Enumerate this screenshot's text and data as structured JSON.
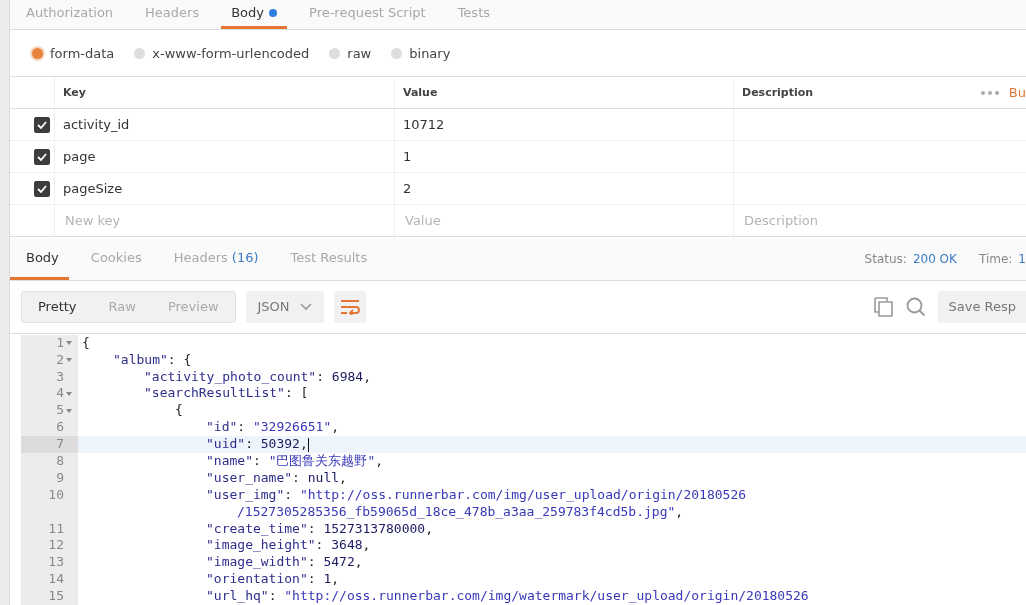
{
  "request_tabs": [
    {
      "label": "Authorization",
      "selected": false,
      "modified": false
    },
    {
      "label": "Headers",
      "selected": false,
      "modified": false
    },
    {
      "label": "Body",
      "selected": true,
      "modified": true
    },
    {
      "label": "Pre-request Script",
      "selected": false,
      "modified": false
    },
    {
      "label": "Tests",
      "selected": false,
      "modified": false
    }
  ],
  "body_modes": [
    {
      "label": "form-data",
      "selected": true
    },
    {
      "label": "x-www-form-urlencoded",
      "selected": false
    },
    {
      "label": "raw",
      "selected": false
    },
    {
      "label": "binary",
      "selected": false
    }
  ],
  "params_table": {
    "columns": [
      "Key",
      "Value",
      "Description"
    ],
    "bulk_edit": "Bu",
    "rows": [
      {
        "checked": true,
        "key": "activity_id",
        "value": "10712"
      },
      {
        "checked": true,
        "key": "page",
        "value": "1"
      },
      {
        "checked": true,
        "key": "pageSize",
        "value": "2"
      }
    ],
    "new_row": {
      "key_placeholder": "New key",
      "value_placeholder": "Value",
      "description_placeholder": "Description"
    }
  },
  "response_tabs": [
    {
      "label": "Body",
      "selected": true
    },
    {
      "label": "Cookies",
      "selected": false
    },
    {
      "label": "Headers",
      "count": "(16)",
      "selected": false
    },
    {
      "label": "Test Results",
      "selected": false
    }
  ],
  "status": {
    "label": "Status:",
    "value": "200 OK",
    "time_label": "Time:",
    "time_value": "1"
  },
  "view_modes": [
    {
      "label": "Pretty",
      "selected": true
    },
    {
      "label": "Raw",
      "selected": false
    },
    {
      "label": "Preview",
      "selected": false
    }
  ],
  "format": "JSON",
  "save_button": "Save Resp",
  "code": [
    {
      "n": "1",
      "fold": true,
      "current": false,
      "tokens": [
        {
          "kind": "punct",
          "t": "{"
        }
      ],
      "children": [
        {
          "n": "2",
          "fold": true,
          "current": false,
          "tokens": [
            {
              "kind": "key",
              "t": "\"album\""
            },
            {
              "kind": "punct",
              "t": ": {"
            }
          ],
          "children": [
            {
              "n": "3",
              "fold": false,
              "current": false,
              "tokens": [
                {
                  "kind": "key",
                  "t": "\"activity_photo_count\""
                },
                {
                  "kind": "punct",
                  "t": ": "
                },
                {
                  "kind": "number",
                  "t": "6984"
                },
                {
                  "kind": "punct",
                  "t": ","
                }
              ]
            },
            {
              "n": "4",
              "fold": true,
              "current": false,
              "tokens": [
                {
                  "kind": "key",
                  "t": "\"searchResultList\""
                },
                {
                  "kind": "punct",
                  "t": ": ["
                }
              ],
              "children": [
                {
                  "n": "5",
                  "fold": true,
                  "current": false,
                  "tokens": [
                    {
                      "kind": "punct",
                      "t": "{"
                    }
                  ],
                  "children": [
                    {
                      "n": "6",
                      "fold": false,
                      "current": false,
                      "tokens": [
                        {
                          "kind": "key",
                          "t": "\"id\""
                        },
                        {
                          "kind": "punct",
                          "t": ": "
                        },
                        {
                          "kind": "string",
                          "t": "\"32926651\""
                        },
                        {
                          "kind": "punct",
                          "t": ","
                        }
                      ]
                    },
                    {
                      "n": "7",
                      "fold": false,
                      "current": true,
                      "tokens": [
                        {
                          "kind": "key",
                          "t": "\"uid\""
                        },
                        {
                          "kind": "punct",
                          "t": ": "
                        },
                        {
                          "kind": "number",
                          "t": "50392"
                        },
                        {
                          "kind": "punct",
                          "t": ","
                        }
                      ]
                    },
                    {
                      "n": "8",
                      "fold": false,
                      "current": false,
                      "tokens": [
                        {
                          "kind": "key",
                          "t": "\"name\""
                        },
                        {
                          "kind": "punct",
                          "t": ": "
                        },
                        {
                          "kind": "string",
                          "t": "\"巴图鲁关东越野\""
                        },
                        {
                          "kind": "punct",
                          "t": ","
                        }
                      ]
                    },
                    {
                      "n": "9",
                      "fold": false,
                      "current": false,
                      "tokens": [
                        {
                          "kind": "key",
                          "t": "\"user_name\""
                        },
                        {
                          "kind": "punct",
                          "t": ": "
                        },
                        {
                          "kind": "number",
                          "t": "null"
                        },
                        {
                          "kind": "punct",
                          "t": ","
                        }
                      ]
                    },
                    {
                      "n": "10",
                      "fold": false,
                      "current": false,
                      "tokens": [
                        {
                          "kind": "key",
                          "t": "\"user_img\""
                        },
                        {
                          "kind": "punct",
                          "t": ": "
                        },
                        {
                          "kind": "string",
                          "t": "\"http://oss.runnerbar.com/img/user_upload/origin/20180526"
                        }
                      ],
                      "continuation": [
                        {
                          "kind": "string",
                          "t": "/1527305285356_fb59065d_18ce_478b_a3aa_259783f4cd5b.jpg\""
                        },
                        {
                          "kind": "punct",
                          "t": ","
                        }
                      ]
                    },
                    {
                      "n": "11",
                      "fold": false,
                      "current": false,
                      "tokens": [
                        {
                          "kind": "key",
                          "t": "\"create_time\""
                        },
                        {
                          "kind": "punct",
                          "t": ": "
                        },
                        {
                          "kind": "number",
                          "t": "1527313780000"
                        },
                        {
                          "kind": "punct",
                          "t": ","
                        }
                      ]
                    },
                    {
                      "n": "12",
                      "fold": false,
                      "current": false,
                      "tokens": [
                        {
                          "kind": "key",
                          "t": "\"image_height\""
                        },
                        {
                          "kind": "punct",
                          "t": ": "
                        },
                        {
                          "kind": "number",
                          "t": "3648"
                        },
                        {
                          "kind": "punct",
                          "t": ","
                        }
                      ]
                    },
                    {
                      "n": "13",
                      "fold": false,
                      "current": false,
                      "tokens": [
                        {
                          "kind": "key",
                          "t": "\"image_width\""
                        },
                        {
                          "kind": "punct",
                          "t": ": "
                        },
                        {
                          "kind": "number",
                          "t": "5472"
                        },
                        {
                          "kind": "punct",
                          "t": ","
                        }
                      ]
                    },
                    {
                      "n": "14",
                      "fold": false,
                      "current": false,
                      "tokens": [
                        {
                          "kind": "key",
                          "t": "\"orientation\""
                        },
                        {
                          "kind": "punct",
                          "t": ": "
                        },
                        {
                          "kind": "number",
                          "t": "1"
                        },
                        {
                          "kind": "punct",
                          "t": ","
                        }
                      ]
                    },
                    {
                      "n": "15",
                      "fold": false,
                      "current": false,
                      "tokens": [
                        {
                          "kind": "key",
                          "t": "\"url_hq\""
                        },
                        {
                          "kind": "punct",
                          "t": ": "
                        },
                        {
                          "kind": "string",
                          "t": "\"http://oss.runnerbar.com/img/watermark/user_upload/origin/20180526"
                        }
                      ]
                    }
                  ]
                }
              ]
            }
          ]
        }
      ]
    }
  ]
}
